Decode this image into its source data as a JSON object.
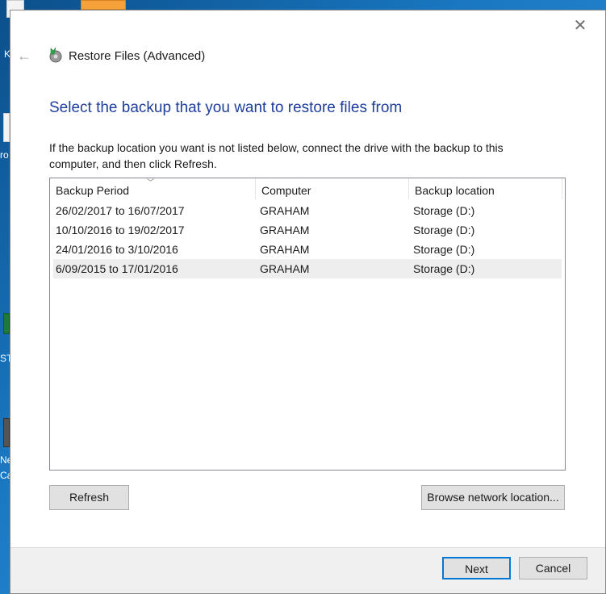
{
  "desktop": {
    "labels": [
      "K",
      "ro",
      "ST",
      "Ne",
      "Ca"
    ]
  },
  "window": {
    "title": "Restore Files (Advanced)",
    "close_glyph": "✕",
    "back_glyph": "←"
  },
  "main": {
    "heading": "Select the backup that you want to restore files from",
    "instruction": "If the backup location you want is not listed below, connect the drive with the backup to this computer, and then click Refresh."
  },
  "table": {
    "columns": [
      "Backup Period",
      "Computer",
      "Backup location"
    ],
    "sort_glyph": "﹀",
    "rows": [
      [
        "26/02/2017 to 16/07/2017",
        "GRAHAM",
        "Storage (D:)"
      ],
      [
        "10/10/2016 to 19/02/2017",
        "GRAHAM",
        "Storage (D:)"
      ],
      [
        "24/01/2016 to 3/10/2016",
        "GRAHAM",
        "Storage (D:)"
      ],
      [
        "6/09/2015 to 17/01/2016",
        "GRAHAM",
        "Storage (D:)"
      ]
    ]
  },
  "buttons": {
    "refresh": "Refresh",
    "browse": "Browse network location...",
    "next": "Next",
    "cancel": "Cancel"
  },
  "colors": {
    "heading": "#1e3f9e",
    "focus_border": "#0078d7"
  }
}
